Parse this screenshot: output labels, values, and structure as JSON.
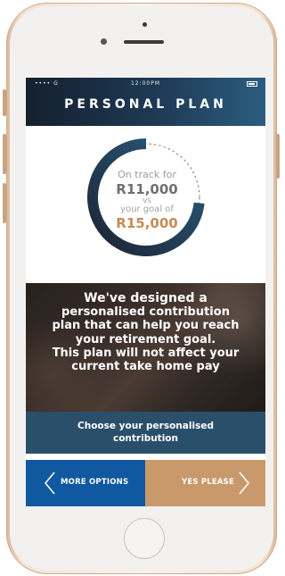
{
  "status_bar": {
    "signal": "•••• G",
    "time": "12:00PM"
  },
  "header": {
    "title": "PERSONAL PLAN"
  },
  "progress": {
    "on_track_label": "On track for",
    "on_track_amount": "R11,000",
    "vs_label": "vs",
    "goal_label": "your goal of",
    "goal_amount": "R15,000",
    "fraction": 0.733
  },
  "message": {
    "lines": [
      "We've designed a",
      "personalised contribution",
      "plan that can help you reach",
      "your retirement goal.",
      "This plan will not affect your",
      "current take home pay"
    ]
  },
  "cta": {
    "line1": "Choose your personalised",
    "line2": "contribution"
  },
  "buttons": {
    "more_options": "MORE OPTIONS",
    "yes_please": "YES PLEASE"
  },
  "colors": {
    "header_start": "#14202e",
    "header_end": "#2b5d80",
    "ring_start": "#1b2533",
    "ring_end": "#2b5d80",
    "goal_amount": "#c58b57",
    "btn_left": "#1059a0",
    "btn_right": "#c9996b",
    "cta_bg": "#2a4f6b"
  },
  "icons": {
    "left_chevron": "chevron-left-icon",
    "right_chevron": "chevron-right-icon"
  }
}
